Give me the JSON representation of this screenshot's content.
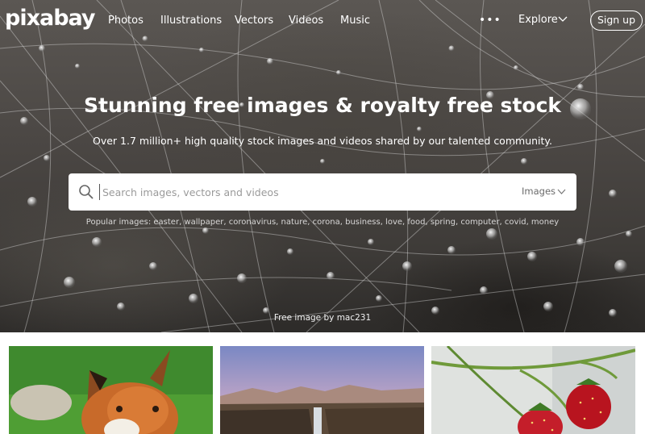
{
  "header": {
    "logo": "pixabay",
    "nav": [
      "Photos",
      "Illustrations",
      "Vectors",
      "Videos",
      "Music"
    ],
    "more": "•••",
    "explore": "Explore",
    "signup": "Sign up"
  },
  "hero": {
    "title": "Stunning free images & royalty free stock",
    "subtitle": "Over 1.7 million+ high quality stock images and videos shared by our talented community.",
    "credit": "Free image by mac231"
  },
  "search": {
    "placeholder": "Search images, vectors and videos",
    "type": "Images"
  },
  "popular": {
    "label": "Popular images:",
    "terms": "easter, wallpaper, coronavirus, nature, corona, business, love, food, spring, computer, covid, money"
  },
  "icons": [
    "search-icon",
    "chevron-down-icon",
    "more-icon"
  ],
  "colors": {
    "accent": "#ffffff",
    "search_bg": "#ffffff"
  }
}
